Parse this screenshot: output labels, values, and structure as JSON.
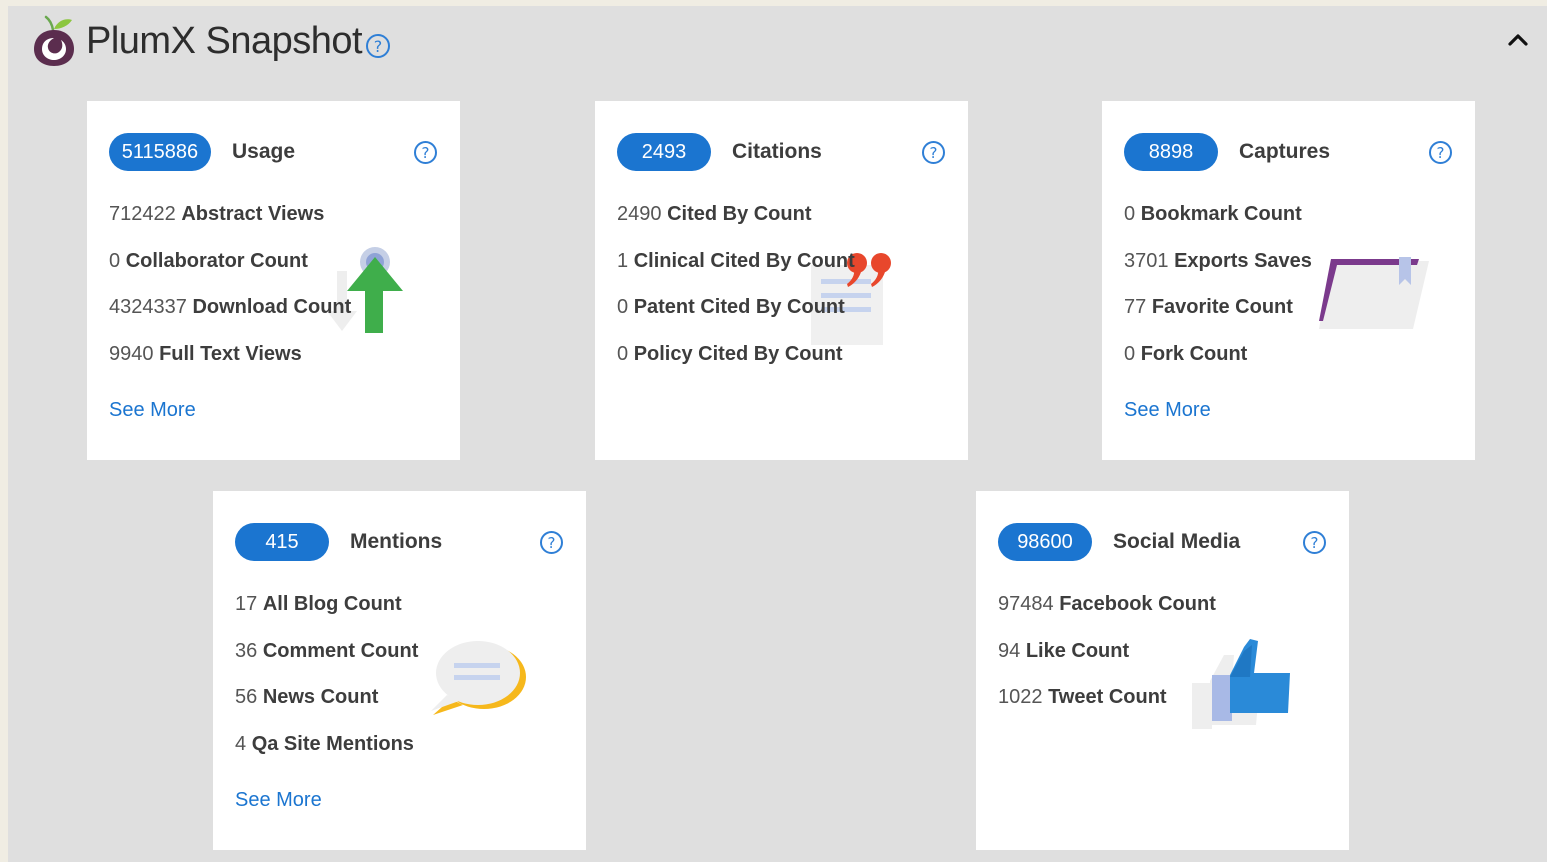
{
  "header": {
    "title": "PlumX Snapshot",
    "logo_icon": "plumx-plum-logo",
    "help_icon": "question-circle-icon",
    "collapse_icon": "chevron-up-icon"
  },
  "colors": {
    "badge": "#1b75d0",
    "link": "#1b75d0",
    "widget_bg": "#dfdfdf",
    "card_bg": "#ffffff"
  },
  "cards": [
    {
      "key": "usage",
      "count": "5115886",
      "label": "Usage",
      "icon": "upload-arrow-icon",
      "metrics": [
        {
          "value": "712422",
          "label": "Abstract Views"
        },
        {
          "value": "0",
          "label": "Collaborator Count"
        },
        {
          "value": "4324337",
          "label": "Download Count"
        },
        {
          "value": "9940",
          "label": "Full Text Views"
        }
      ],
      "see_more": "See More"
    },
    {
      "key": "citations",
      "count": "2493",
      "label": "Citations",
      "icon": "quote-document-icon",
      "metrics": [
        {
          "value": "2490",
          "label": "Cited By Count"
        },
        {
          "value": "1",
          "label": "Clinical Cited By Count"
        },
        {
          "value": "0",
          "label": "Patent Cited By Count"
        },
        {
          "value": "0",
          "label": "Policy Cited By Count"
        }
      ]
    },
    {
      "key": "captures",
      "count": "8898",
      "label": "Captures",
      "icon": "bookmark-folder-icon",
      "metrics": [
        {
          "value": "0",
          "label": "Bookmark Count"
        },
        {
          "value": "3701",
          "label": "Exports Saves"
        },
        {
          "value": "77",
          "label": "Favorite Count"
        },
        {
          "value": "0",
          "label": "Fork Count"
        }
      ],
      "see_more": "See More"
    },
    {
      "key": "mentions",
      "count": "415",
      "label": "Mentions",
      "icon": "speech-bubble-icon",
      "metrics": [
        {
          "value": "17",
          "label": "All Blog Count"
        },
        {
          "value": "36",
          "label": "Comment Count"
        },
        {
          "value": "56",
          "label": "News Count"
        },
        {
          "value": "4",
          "label": "Qa Site Mentions"
        }
      ],
      "see_more": "See More"
    },
    {
      "key": "social-media",
      "count": "98600",
      "label": "Social Media",
      "icon": "thumbs-up-icon",
      "metrics": [
        {
          "value": "97484",
          "label": "Facebook Count"
        },
        {
          "value": "94",
          "label": "Like Count"
        },
        {
          "value": "1022",
          "label": "Tweet Count"
        }
      ]
    }
  ]
}
